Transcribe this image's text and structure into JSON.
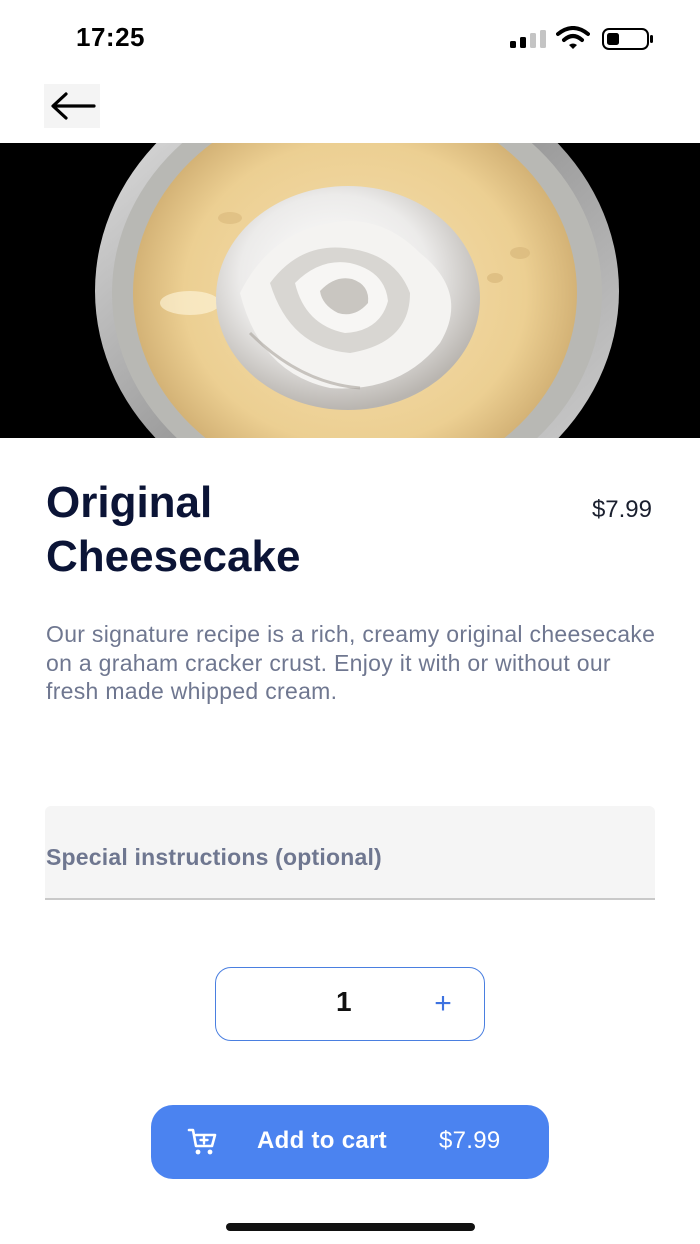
{
  "status_bar": {
    "time": "17:25"
  },
  "navigation": {
    "back_icon": "arrow-left-icon"
  },
  "hero": {
    "icon": "cheesecake-photo"
  },
  "product": {
    "title": "Original Cheesecake",
    "price": "$7.99",
    "description": "Our signature recipe is a rich, creamy original cheesecake on a graham cracker crust. Enjoy it with or without our fresh made whipped cream."
  },
  "instructions": {
    "label": "Special instructions (optional)",
    "value": ""
  },
  "quantity": {
    "value": "1",
    "plus_label": "+"
  },
  "cart_button": {
    "label": "Add to cart",
    "price": "$7.99",
    "icon": "cart-plus-icon"
  },
  "colors": {
    "accent": "#4b83f0",
    "title": "#0b1436",
    "muted_text": "#6f7790"
  }
}
